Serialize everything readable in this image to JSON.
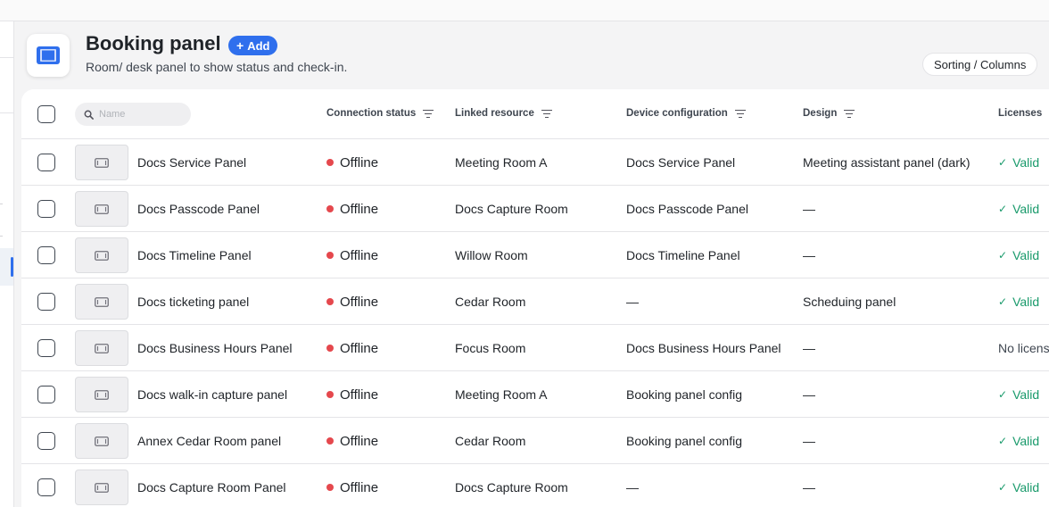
{
  "page": {
    "title": "Booking panel",
    "add_label": "Add",
    "subtitle": "Room/ desk panel to show status and check-in.",
    "sort_columns_label": "Sorting / Columns"
  },
  "search": {
    "placeholder": "Name",
    "value": ""
  },
  "columns": {
    "status": "Connection status",
    "resource": "Linked resource",
    "config": "Device configuration",
    "design": "Design",
    "licenses": "Licenses"
  },
  "colors": {
    "accent": "#2f6fed",
    "offline": "#e5484d",
    "valid": "#199a6b"
  },
  "rows": [
    {
      "name": "Docs Service Panel",
      "status": "Offline",
      "resource": "Meeting Room A",
      "config": "Docs Service Panel",
      "design": "Meeting assistant panel (dark)",
      "license": "Valid"
    },
    {
      "name": "Docs Passcode Panel",
      "status": "Offline",
      "resource": "Docs Capture Room",
      "config": "Docs Passcode Panel",
      "design": "—",
      "license": "Valid"
    },
    {
      "name": "Docs Timeline Panel",
      "status": "Offline",
      "resource": "Willow Room",
      "config": "Docs Timeline Panel",
      "design": "—",
      "license": "Valid"
    },
    {
      "name": "Docs ticketing panel",
      "status": "Offline",
      "resource": "Cedar Room",
      "config": "—",
      "design": "Scheduing panel",
      "license": "Valid"
    },
    {
      "name": "Docs Business Hours Panel",
      "status": "Offline",
      "resource": "Focus Room",
      "config": "Docs Business Hours Panel",
      "design": "—",
      "license": "No license"
    },
    {
      "name": "Docs walk-in capture panel",
      "status": "Offline",
      "resource": "Meeting Room A",
      "config": "Booking panel config",
      "design": "—",
      "license": "Valid"
    },
    {
      "name": "Annex Cedar Room panel",
      "status": "Offline",
      "resource": "Cedar Room",
      "config": "Booking panel config",
      "design": "—",
      "license": "Valid"
    },
    {
      "name": "Docs Capture Room Panel",
      "status": "Offline",
      "resource": "Docs Capture Room",
      "config": "—",
      "design": "—",
      "license": "Valid"
    }
  ]
}
